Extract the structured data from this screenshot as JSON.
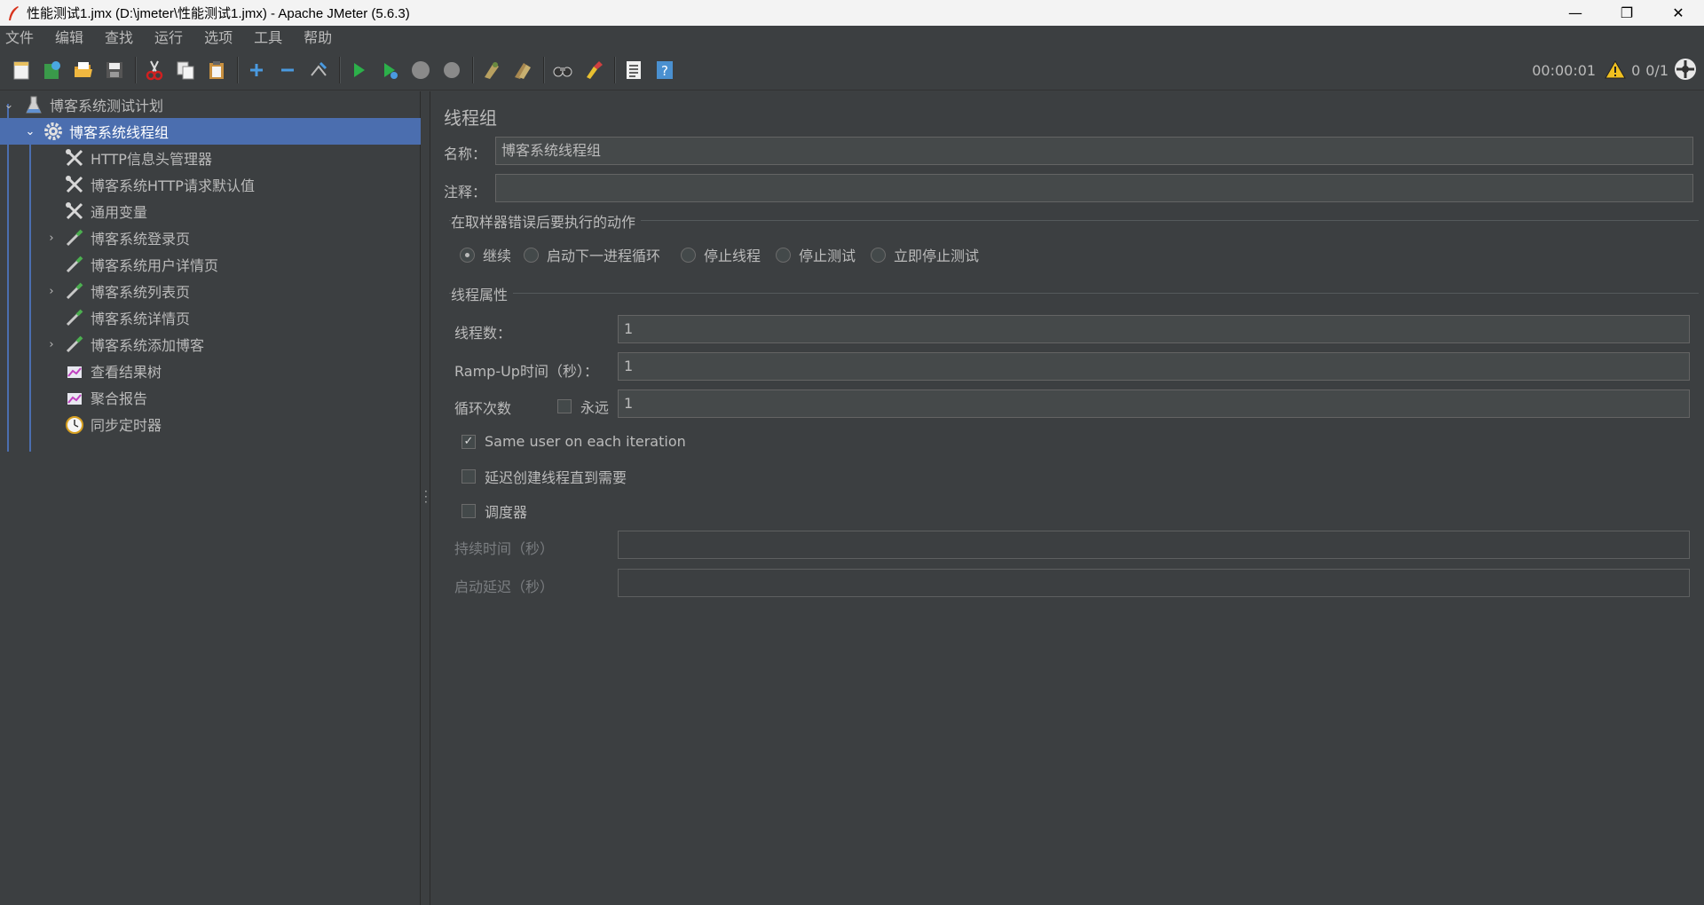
{
  "window": {
    "title": "性能测试1.jmx (D:\\jmeter\\性能测试1.jmx) - Apache JMeter (5.6.3)",
    "minimize": "—",
    "restore": "❐",
    "close": "✕"
  },
  "menu": [
    "文件",
    "编辑",
    "查找",
    "运行",
    "选项",
    "工具",
    "帮助"
  ],
  "status": {
    "elapsed": "00:00:01",
    "warnings": "0",
    "threads": "0/1"
  },
  "tree": {
    "items": [
      {
        "label": "博客系统测试计划",
        "icon": "flask-icon"
      },
      {
        "label": "博客系统线程组",
        "icon": "gear-icon"
      },
      {
        "label": "HTTP信息头管理器",
        "icon": "wrench-icon"
      },
      {
        "label": "博客系统HTTP请求默认值",
        "icon": "wrench-icon"
      },
      {
        "label": "通用变量",
        "icon": "wrench-icon"
      },
      {
        "label": "博客系统登录页",
        "icon": "pipette-icon"
      },
      {
        "label": "博客系统用户详情页",
        "icon": "pipette-icon"
      },
      {
        "label": "博客系统列表页",
        "icon": "pipette-icon"
      },
      {
        "label": "博客系统详情页",
        "icon": "pipette-icon"
      },
      {
        "label": "博客系统添加博客",
        "icon": "pipette-icon"
      },
      {
        "label": "查看结果树",
        "icon": "chart-icon"
      },
      {
        "label": "聚合报告",
        "icon": "chart-icon"
      },
      {
        "label": "同步定时器",
        "icon": "timer-icon"
      }
    ]
  },
  "panel": {
    "title": "线程组",
    "name_label": "名称：",
    "name_value": "博客系统线程组",
    "comment_label": "注释：",
    "comment_value": "",
    "error_section": "在取样器错误后要执行的动作",
    "error_options": [
      "继续",
      "启动下一进程循环",
      "停止线程",
      "停止测试",
      "立即停止测试"
    ],
    "thread_section": "线程属性",
    "threads_label": "线程数：",
    "threads_value": "1",
    "rampup_label": "Ramp-Up时间（秒）：",
    "rampup_value": "1",
    "loop_label": "循环次数",
    "forever_label": "永远",
    "loop_value": "1",
    "same_user_label": "Same user on each iteration",
    "delay_label": "延迟创建线程直到需要",
    "scheduler_label": "调度器",
    "duration_label": "持续时间（秒）",
    "duration_value": "",
    "startup_label": "启动延迟（秒）",
    "startup_value": ""
  }
}
